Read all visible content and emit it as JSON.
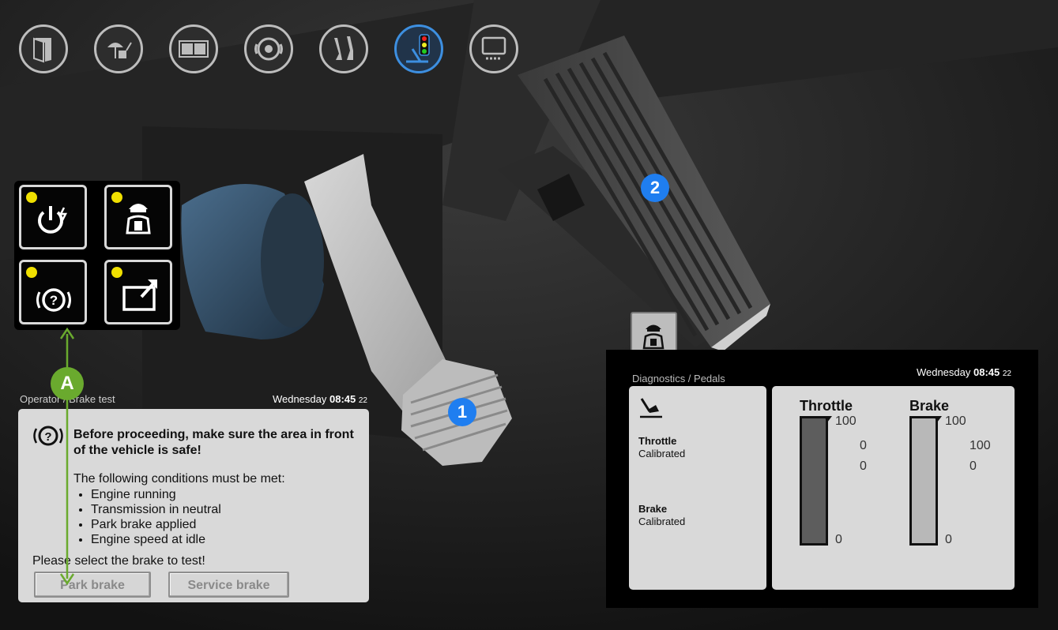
{
  "colors": {
    "accent": "#3d8fe0",
    "callout_blue": "#1f7ef0",
    "callout_green": "#6aaa2e",
    "led_yellow": "#f0e000",
    "panel": "#d9d9d9"
  },
  "topnav": {
    "items": [
      {
        "icon": "door-panel-icon"
      },
      {
        "icon": "cleaning-icon"
      },
      {
        "icon": "windows-icon"
      },
      {
        "icon": "brake-disc-icon"
      },
      {
        "icon": "pedals-icon"
      },
      {
        "icon": "traffic-light-icon",
        "active": true
      },
      {
        "icon": "display-icon"
      }
    ]
  },
  "side_grid": {
    "buttons": [
      {
        "icon": "power-icon",
        "led": "yellow"
      },
      {
        "icon": "operator-icon",
        "led": "yellow"
      },
      {
        "icon": "brake-warning-icon",
        "led": "yellow"
      },
      {
        "icon": "export-icon",
        "led": "yellow"
      }
    ]
  },
  "brake_dialog": {
    "breadcrumb": "Operator / Brake test",
    "time": {
      "day": "Wednesday",
      "clock": "08:45",
      "sec": "22"
    },
    "warning": "Before proceeding, make sure the area in front of the vehicle is safe!",
    "intro": "The following conditions must be met:",
    "conditions": [
      "Engine running",
      "Transmission in neutral",
      "Park brake applied",
      "Engine speed at idle"
    ],
    "prompt": "Please select the brake to test!",
    "buttons": {
      "park": "Park brake",
      "service": "Service brake"
    }
  },
  "diagnostics": {
    "breadcrumb": "Diagnostics / Pedals",
    "time": {
      "day": "Wednesday",
      "clock": "08:45",
      "sec": "22"
    },
    "pedals_status": [
      {
        "name": "Throttle",
        "status": "Calibrated"
      },
      {
        "name": "Brake",
        "status": "Calibrated"
      }
    ],
    "gauges": [
      {
        "title": "Throttle",
        "max": "100",
        "min": "0",
        "readout1": "0",
        "readout2": "0",
        "level": 0
      },
      {
        "title": "Brake",
        "max": "100",
        "min": "0",
        "readout1": "100",
        "readout2": "0",
        "level": 0
      }
    ]
  },
  "callouts": {
    "one": "1",
    "two": "2",
    "a": "A"
  }
}
